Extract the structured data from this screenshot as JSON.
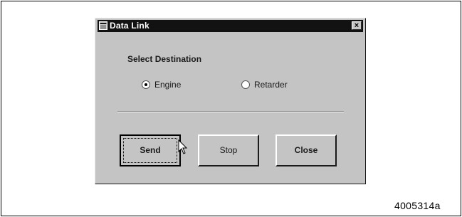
{
  "window": {
    "title": "Data Link",
    "close_glyph": "×"
  },
  "destination": {
    "label": "Select Destination",
    "options": [
      {
        "label": "Engine",
        "selected": true
      },
      {
        "label": "Retarder",
        "selected": false
      }
    ]
  },
  "buttons": {
    "send": "Send",
    "stop": "Stop",
    "close": "Close"
  },
  "figure_ref": "4005314a",
  "colors": {
    "titlebar": "#121212",
    "window_bg": "#c4c4c4"
  },
  "icons": {
    "title": "app-window-icon",
    "cursor": "mouse-pointer-icon"
  }
}
